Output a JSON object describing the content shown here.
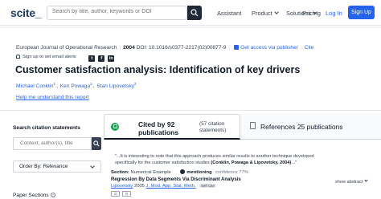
{
  "nav": {
    "logo": "scite_",
    "search_placeholder": "Search by title, author, keywords or DOI",
    "assistant": "Assistant",
    "product": "Product",
    "solutions": "Solutions",
    "pricing": "Pricing",
    "login": "Log In",
    "signup": "Sign Up"
  },
  "paper": {
    "journal": "European Journal of Operational Research",
    "year": "2004",
    "doi": "DOI: 10.1016/s0377-2217(02)00877-9",
    "access_link": "Get access via publisher",
    "cite": "Cite",
    "alerts": "Sign up to set email alerts",
    "title": "Customer satisfaction analysis: Identification of key drivers",
    "authors": [
      {
        "name": "Michael Conklin",
        "sup": "1"
      },
      {
        "name": "Ken Powaga",
        "sup": "2"
      },
      {
        "name": "Stan Lipovetsky",
        "sup": "3"
      }
    ],
    "help_link": "Help me understand this report"
  },
  "sidebar": {
    "search_label": "Search citation statements",
    "search_placeholder": "Context, author(s), title etc",
    "order_by": "Order By: Relevance",
    "popup_sections": "Paper Sections"
  },
  "tabs": {
    "cited_by": "Cited by 92",
    "publications": "publications",
    "cited_sub_1": "(57 citation",
    "cited_sub_2": "statements)",
    "references": "References 25 publications"
  },
  "citation": {
    "snippet_1": "\"...It is interesting to note that this approach produces similar results to another technique developed",
    "snippet_2a": "specifically for the customer satisfaction studies",
    "snippet_2b": "(Conklin, Powaga & Lipovetsky, 2004)",
    "snippet_2c": "...\"",
    "section_label": "Section:",
    "section_value": "Numerical Example",
    "mentioning": "mentioning",
    "confidence": "confidence 77%",
    "show_abstract": "show abstract",
    "next_title": "Regression By Data Segments Via Discriminant Analysis",
    "next_author": "Lipovetsky",
    "next_year": "2005",
    "next_journal": "J. Mod. App. Stat. Meth.",
    "self_cite": "Self Cite",
    "next_badge_1": "0",
    "next_badge_2": "0"
  }
}
